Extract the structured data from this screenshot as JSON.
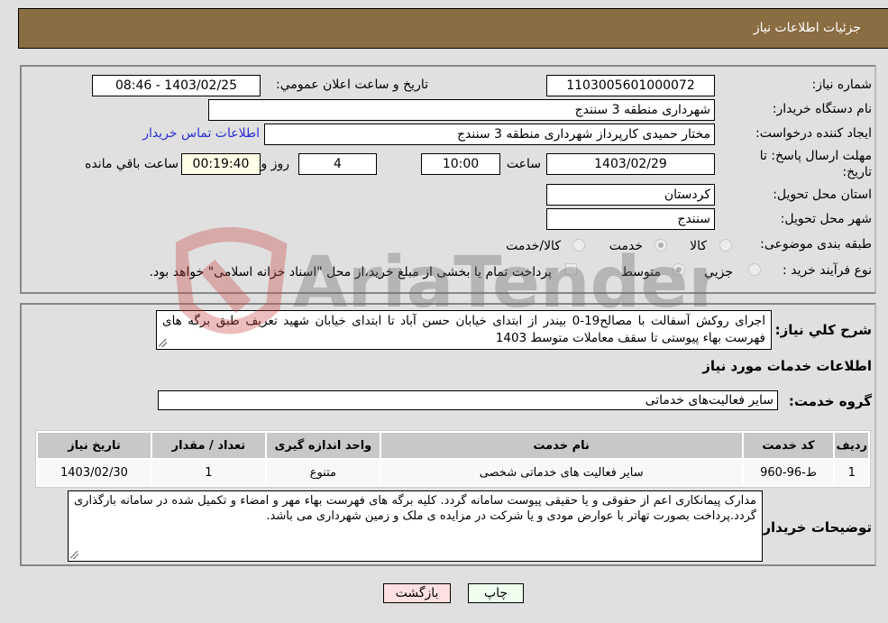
{
  "header": {
    "title": "جزئیات اطلاعات نیاز"
  },
  "form": {
    "need_number_label": "شماره نیاز:",
    "need_number": "1103005601000072",
    "announce_label": "تاریخ و ساعت اعلان عمومي:",
    "announce_value": "1403/02/25 - 08:46",
    "buyer_org_label": "نام دستگاه خريدار:",
    "buyer_org": "شهرداری منطقه 3 سنندج",
    "creator_label": "ایجاد کننده درخواست:",
    "creator": "مختار حمیدی کارپرداز شهرداری منطقه 3 سنندج",
    "contact_link": "اطلاعات تماس خريدار",
    "deadline_label_line1": "مهلت ارسال پاسخ: تا",
    "deadline_label_line2": "تاریخ:",
    "deadline_date": "1403/02/29",
    "time_label": "ساعت",
    "deadline_time": "10:00",
    "days_value": "4",
    "days_label": "روز و",
    "remaining_time": "00:19:40",
    "remaining_label": "ساعت باقي مانده",
    "province_label": "استان محل تحویل:",
    "province": "کردستان",
    "city_label": "شهر محل تحویل:",
    "city": "سنندج",
    "category_label": "طبقه بندی موضوعی:",
    "category_options": [
      {
        "label": "کالا",
        "checked": false
      },
      {
        "label": "خدمت",
        "checked": true
      },
      {
        "label": "کالا/خدمت",
        "checked": false
      }
    ],
    "process_label": "نوع فرآیند خرید :",
    "process_options": [
      {
        "label": "جزيي",
        "checked": false
      },
      {
        "label": "متوسط",
        "checked": true
      }
    ],
    "treasury_note": "پرداخت تمام یا بخشی از مبلغ خرید،از محل \"اسناد خزانه اسلامی\" خواهد بود."
  },
  "details": {
    "description_label": "شرح کلي نياز:",
    "description": "اجرای روکش آسفالت با مصالح19-0 بیندر از ابتدای خیابان حسن آباد تا ابتدای خیابان شهید تعریف طبق برگه های فهرست بهاء پیوستی تا سقف معاملات متوسط 1403",
    "services_heading": "اطلاعات خدمات مورد نياز",
    "service_group_label": "گروه خدمت:",
    "service_group": "سایر فعالیت‌های خدماتی",
    "table": {
      "headers": [
        "رديف",
        "کد خدمت",
        "نام خدمت",
        "واحد اندازه گيری",
        "تعداد / مقدار",
        "تاريخ نياز"
      ],
      "rows": [
        [
          "1",
          "ط-96-960",
          "سایر فعالیت های خدماتی شخصی",
          "متنوع",
          "1",
          "1403/02/30"
        ]
      ]
    },
    "buyer_notes_label": "توضيحات خريدار:",
    "buyer_notes": "مدارک پیمانکاری اعم از حقوقی و یا حقیقی پیوست سامانه گردد. کلیه برگه های فهرست بهاء مهر و امضاء و تکمیل شده در سامانه بارگذاری گردد.پرداخت بصورت تهاتر با عوارض مودی و یا شرکت در مزایده ی ملک و زمین شهرداری می باشد."
  },
  "buttons": {
    "print": "چاپ",
    "back": "بازگشت"
  },
  "watermark": {
    "text": "AriaTender.neT"
  }
}
